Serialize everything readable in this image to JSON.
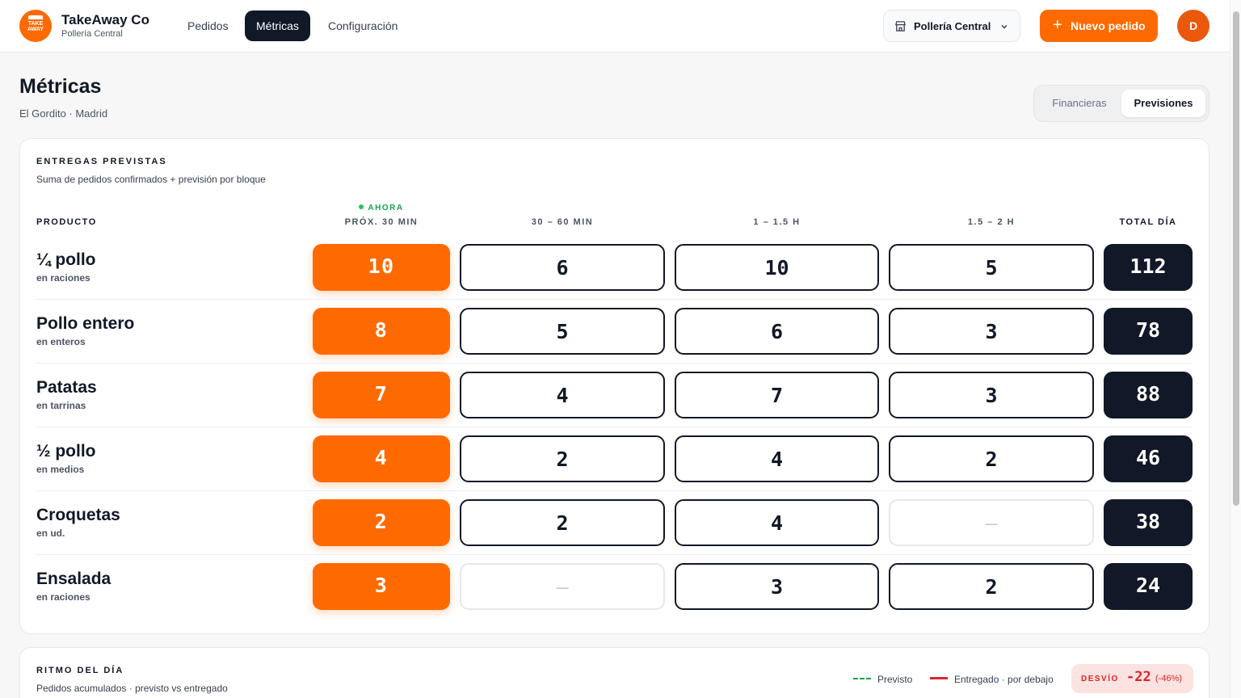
{
  "brand": {
    "name": "TakeAway Co",
    "subtitle": "Pollería Central",
    "logo_text": "TAKE AWAY"
  },
  "nav": [
    {
      "label": "Pedidos",
      "active": false
    },
    {
      "label": "Métricas",
      "active": true
    },
    {
      "label": "Configuración",
      "active": false
    }
  ],
  "store_selector": {
    "label": "Pollería Central",
    "icon": "store-icon"
  },
  "new_order_button": {
    "label": "Nuevo pedido",
    "icon": "plus-icon"
  },
  "avatar": {
    "initial": "D"
  },
  "page": {
    "title": "Métricas",
    "subtitle": "El Gordito · Madrid"
  },
  "view_toggle": {
    "options": [
      "Financieras",
      "Previsiones"
    ],
    "selected": "Previsiones"
  },
  "forecast": {
    "title": "ENTREGAS PREVISTAS",
    "subtitle": "Suma de pedidos confirmados + previsión por bloque",
    "now_label": "AHORA",
    "columns": {
      "product": "PRODUCTO",
      "block1": "PRÓX. 30 MIN",
      "block2": "30 – 60 MIN",
      "block3": "1 – 1.5 H",
      "block4": "1.5 – 2 H",
      "total": "TOTAL DÍA"
    },
    "rows": [
      {
        "name": "¼ pollo",
        "unit": "en raciones",
        "b1": "10",
        "b2": "6",
        "b3": "10",
        "b4": "5",
        "total": "112"
      },
      {
        "name": "Pollo entero",
        "unit": "en enteros",
        "b1": "8",
        "b2": "5",
        "b3": "6",
        "b4": "3",
        "total": "78"
      },
      {
        "name": "Patatas",
        "unit": "en tarrinas",
        "b1": "7",
        "b2": "4",
        "b3": "7",
        "b4": "3",
        "total": "88"
      },
      {
        "name": "½ pollo",
        "unit": "en medios",
        "b1": "4",
        "b2": "2",
        "b3": "4",
        "b4": "2",
        "total": "46"
      },
      {
        "name": "Croquetas",
        "unit": "en ud.",
        "b1": "2",
        "b2": "2",
        "b3": "4",
        "b4": "–",
        "total": "38"
      },
      {
        "name": "Ensalada",
        "unit": "en raciones",
        "b1": "3",
        "b2": "–",
        "b3": "3",
        "b4": "2",
        "total": "24"
      }
    ]
  },
  "rhythm": {
    "title": "RITMO DEL DÍA",
    "subtitle": "Pedidos acumulados · previsto vs entregado",
    "legend": {
      "forecast": "Previsto",
      "delivered": "Entregado · por debajo"
    },
    "deviation": {
      "label": "DESVÍO",
      "value": "-22",
      "percent": "(-46%)"
    }
  },
  "colors": {
    "accent": "#ff6a00",
    "dark": "#111827",
    "now": "#22c55e",
    "danger": "#dc2626"
  }
}
